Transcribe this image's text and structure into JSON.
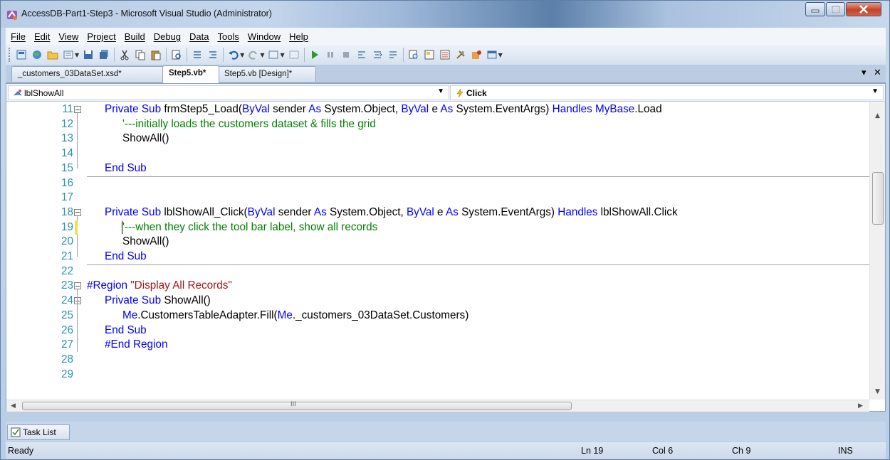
{
  "window": {
    "title": "AccessDB-Part1-Step3 - Microsoft Visual Studio (Administrator)"
  },
  "menu": [
    {
      "label": "File"
    },
    {
      "label": "Edit"
    },
    {
      "label": "View"
    },
    {
      "label": "Project"
    },
    {
      "label": "Build"
    },
    {
      "label": "Debug"
    },
    {
      "label": "Data"
    },
    {
      "label": "Tools"
    },
    {
      "label": "Window"
    },
    {
      "label": "Help"
    }
  ],
  "tabs": [
    {
      "label": "_customers_03DataSet.xsd*"
    },
    {
      "label": "Step5.vb*"
    },
    {
      "label": "Step5.vb [Design]*"
    }
  ],
  "tab_controls": {
    "dropdown": "▾",
    "close": "✕"
  },
  "nav": {
    "object_combo": "lblShowAll",
    "event_combo": "Click"
  },
  "code_lines": [
    {
      "num": "11",
      "parts": [
        [
          "kw",
          "Private Sub "
        ],
        [
          "",
          "frmStep5_Load("
        ],
        [
          "kw",
          "ByVal"
        ],
        [
          "",
          " sender "
        ],
        [
          "kw",
          "As"
        ],
        [
          "",
          " System.Object, "
        ],
        [
          "kw",
          "ByVal"
        ],
        [
          "",
          " e "
        ],
        [
          "kw",
          "As"
        ],
        [
          "",
          " System.EventArgs) "
        ],
        [
          "kw",
          "Handles"
        ],
        [
          "",
          " "
        ],
        [
          "kw",
          "MyBase"
        ],
        [
          "",
          ".Load"
        ]
      ]
    },
    {
      "num": "12",
      "parts": [
        [
          "cm",
          "'---initially loads the customers dataset & fills the grid"
        ]
      ]
    },
    {
      "num": "13",
      "parts": [
        [
          "",
          "ShowAll()"
        ]
      ]
    },
    {
      "num": "14",
      "parts": []
    },
    {
      "num": "15",
      "parts": [
        [
          "kw",
          "End Sub"
        ]
      ]
    },
    {
      "num": "16",
      "parts": []
    },
    {
      "num": "17",
      "parts": []
    },
    {
      "num": "18",
      "parts": [
        [
          "kw",
          "Private Sub "
        ],
        [
          "",
          "lblShowAll_Click("
        ],
        [
          "kw",
          "ByVal"
        ],
        [
          "",
          " sender "
        ],
        [
          "kw",
          "As"
        ],
        [
          "",
          " System.Object, "
        ],
        [
          "kw",
          "ByVal"
        ],
        [
          "",
          " e "
        ],
        [
          "kw",
          "As"
        ],
        [
          "",
          " System.EventArgs) "
        ],
        [
          "kw",
          "Handles"
        ],
        [
          "",
          " lblShowAll.Click"
        ]
      ]
    },
    {
      "num": "19",
      "parts": [
        [
          "cm",
          "'---when they click the tool bar label, show all records"
        ]
      ]
    },
    {
      "num": "20",
      "parts": [
        [
          "",
          "ShowAll()"
        ]
      ]
    },
    {
      "num": "21",
      "parts": [
        [
          "kw",
          "End Sub"
        ]
      ]
    },
    {
      "num": "22",
      "parts": []
    },
    {
      "num": "23",
      "parts": [
        [
          "kw",
          "#Region "
        ],
        [
          "str",
          "\"Display All Records\""
        ]
      ]
    },
    {
      "num": "24",
      "parts": [
        [
          "kw",
          "Private Sub "
        ],
        [
          "",
          "ShowAll()"
        ]
      ]
    },
    {
      "num": "25",
      "parts": [
        [
          "kw",
          "Me"
        ],
        [
          "",
          ".CustomersTableAdapter.Fill("
        ],
        [
          "kw",
          "Me"
        ],
        [
          "",
          "._customers_03DataSet.Customers)"
        ]
      ]
    },
    {
      "num": "26",
      "parts": [
        [
          "kw",
          "End Sub"
        ]
      ]
    },
    {
      "num": "27",
      "parts": [
        [
          "kw",
          "#End Region"
        ]
      ]
    },
    {
      "num": "28",
      "parts": []
    },
    {
      "num": "29",
      "parts": []
    }
  ],
  "hscroll_label": "III",
  "tasklist": {
    "label": "Task List"
  },
  "status": {
    "ready": "Ready",
    "ln": "Ln 19",
    "col": "Col 6",
    "ch": "Ch 9",
    "mode": "INS"
  }
}
